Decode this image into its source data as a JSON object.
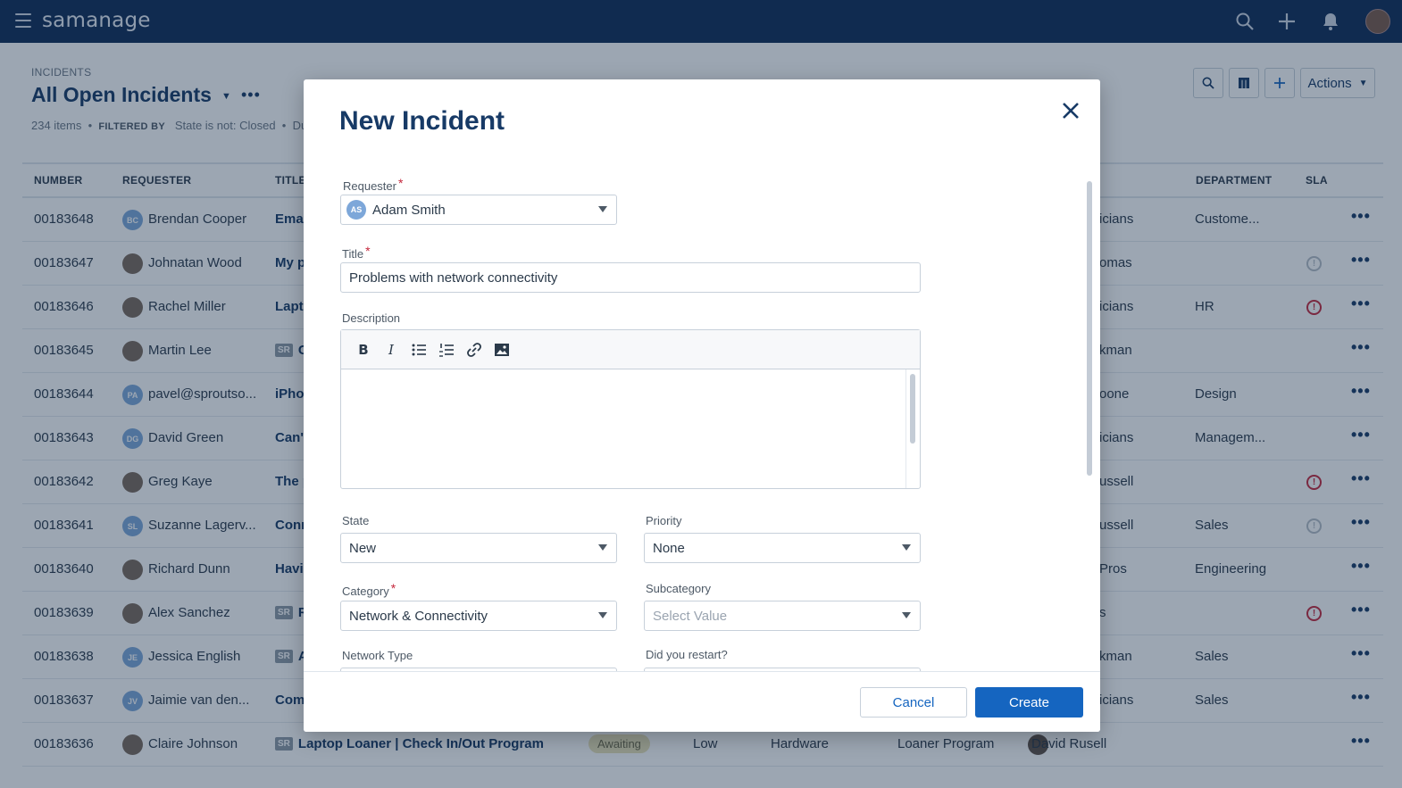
{
  "app": {
    "logo": "samanage",
    "icons": [
      "hamburger-icon",
      "search-icon",
      "plus-icon",
      "bell-icon",
      "user-avatar"
    ]
  },
  "page": {
    "breadcrumb": "INCIDENTS",
    "title": "All Open Incidents",
    "item_count": "234 items",
    "filtered_by_label": "FILTERED BY",
    "filter_state": "State is not: Closed",
    "filter_due": "Due D",
    "actions_label": "Actions"
  },
  "table": {
    "headers": {
      "number": "NUMBER",
      "requester": "REQUESTER",
      "title": "TITLE",
      "department": "DEPARTMENT",
      "sla": "SLA"
    },
    "rows": [
      {
        "number": "00183648",
        "initials": "BC",
        "requester": "Brendan Cooper",
        "title": "Emai",
        "assignee": "icians",
        "department": "Custome...",
        "sla": ""
      },
      {
        "number": "00183647",
        "initials": "",
        "requester": "Johnatan Wood",
        "title": "My p",
        "assignee": "omas",
        "department": "",
        "sla": "grey"
      },
      {
        "number": "00183646",
        "initials": "",
        "requester": "Rachel Miller",
        "title": "Lapto",
        "assignee": "icians",
        "department": "HR",
        "sla": "red"
      },
      {
        "number": "00183645",
        "initials": "",
        "requester": "Martin Lee",
        "title": "C",
        "sr": "SR",
        "assignee": "kman",
        "department": "",
        "sla": ""
      },
      {
        "number": "00183644",
        "initials": "PA",
        "requester": "pavel@sproutso...",
        "title": "iPhor",
        "assignee": "oone",
        "department": "Design",
        "sla": ""
      },
      {
        "number": "00183643",
        "initials": "DG",
        "requester": "David Green",
        "title": "Can't",
        "assignee": "icians",
        "department": "Managem...",
        "sla": ""
      },
      {
        "number": "00183642",
        "initials": "",
        "requester": "Greg Kaye",
        "title": "The p",
        "assignee": "ussell",
        "department": "",
        "sla": "red"
      },
      {
        "number": "00183641",
        "initials": "SL",
        "requester": "Suzanne Lagerv...",
        "title": "Conr",
        "assignee": "ussell",
        "department": "Sales",
        "sla": "grey"
      },
      {
        "number": "00183640",
        "initials": "",
        "requester": "Richard Dunn",
        "title": "Havi",
        "assignee": "Pros",
        "department": "Engineering",
        "sla": ""
      },
      {
        "number": "00183639",
        "initials": "",
        "requester": "Alex Sanchez",
        "title": "R",
        "sr": "SR",
        "assignee": "s",
        "department": "",
        "sla": "red"
      },
      {
        "number": "00183638",
        "initials": "JE",
        "requester": "Jessica English",
        "title": "A",
        "sr": "SR",
        "assignee": "kman",
        "department": "Sales",
        "sla": ""
      },
      {
        "number": "00183637",
        "initials": "JV",
        "requester": "Jaimie van den...",
        "title": "Com",
        "assignee": "icians",
        "department": "Sales",
        "sla": ""
      },
      {
        "number": "00183636",
        "initials": "",
        "requester": "Claire Johnson",
        "title": "Laptop Loaner | Check In/Out Program",
        "sr": "SR",
        "status": "Awaiting",
        "priority": "Low",
        "category": "Hardware",
        "subcategory": "Loaner Program",
        "assignee": "David Rusell",
        "department": "",
        "sla": ""
      }
    ]
  },
  "modal": {
    "title": "New Incident",
    "requester_label": "Requester",
    "requester_initials": "AS",
    "requester_value": "Adam Smith",
    "title_label": "Title",
    "title_value": "Problems with network connectivity",
    "description_label": "Description",
    "state_label": "State",
    "state_value": "New",
    "priority_label": "Priority",
    "priority_value": "None",
    "category_label": "Category",
    "category_value": "Network & Connectivity",
    "subcategory_label": "Subcategory",
    "subcategory_placeholder": "Select Value",
    "network_type_label": "Network Type",
    "restart_label": "Did you restart?",
    "cancel_label": "Cancel",
    "create_label": "Create"
  },
  "colors": {
    "topbar": "#0f2c57",
    "primary": "#1565c0",
    "heading": "#173a66",
    "required": "#c5283d"
  }
}
